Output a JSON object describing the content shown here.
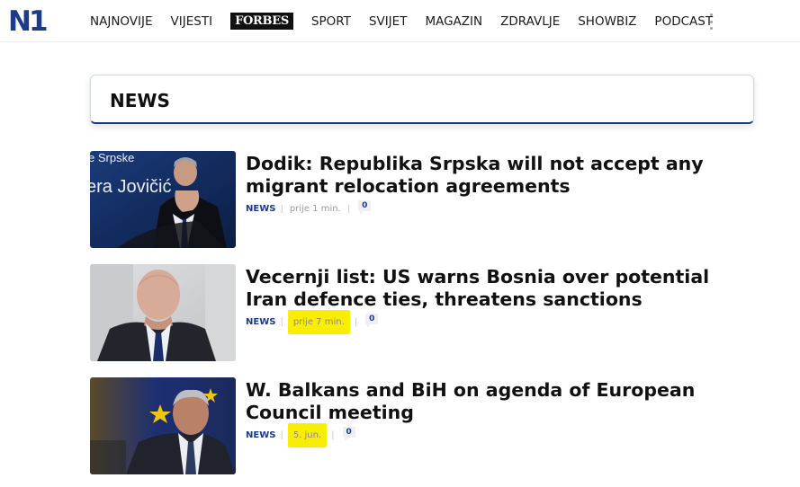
{
  "site": {
    "logo_text": "N1",
    "brand_color": "#1e3a8a"
  },
  "nav": {
    "items": [
      {
        "label": "NAJNOVIJE"
      },
      {
        "label": "VIJESTI"
      },
      {
        "label": "Forbes"
      },
      {
        "label": "SPORT"
      },
      {
        "label": "SVIJET"
      },
      {
        "label": "MAGAZIN"
      },
      {
        "label": "ZDRAVLJE"
      },
      {
        "label": "SHOWBIZ"
      },
      {
        "label": "PODCAST"
      }
    ],
    "more_icon": "more-vertical-icon"
  },
  "section": {
    "title": "NEWS"
  },
  "articles": [
    {
      "headline": "Dodik: Republika Srpska will not accept any migrant relocation agreements",
      "category": "NEWS",
      "time": "prije 1 min.",
      "comments": "0",
      "thumb_text": [
        "e Srpske",
        "era Jovičić"
      ]
    },
    {
      "headline": "Vecernji list: US warns Bosnia over potential Iran defence ties, threatens sanctions",
      "category": "NEWS",
      "time": "prije 7 min.",
      "comments": "0"
    },
    {
      "headline": "W. Balkans and BiH on agenda of European Council meeting",
      "category": "NEWS",
      "time": "5. jun.",
      "comments": "0"
    }
  ],
  "colors": {
    "highlight": "#f7ee00",
    "category": "#1e3a8a"
  }
}
